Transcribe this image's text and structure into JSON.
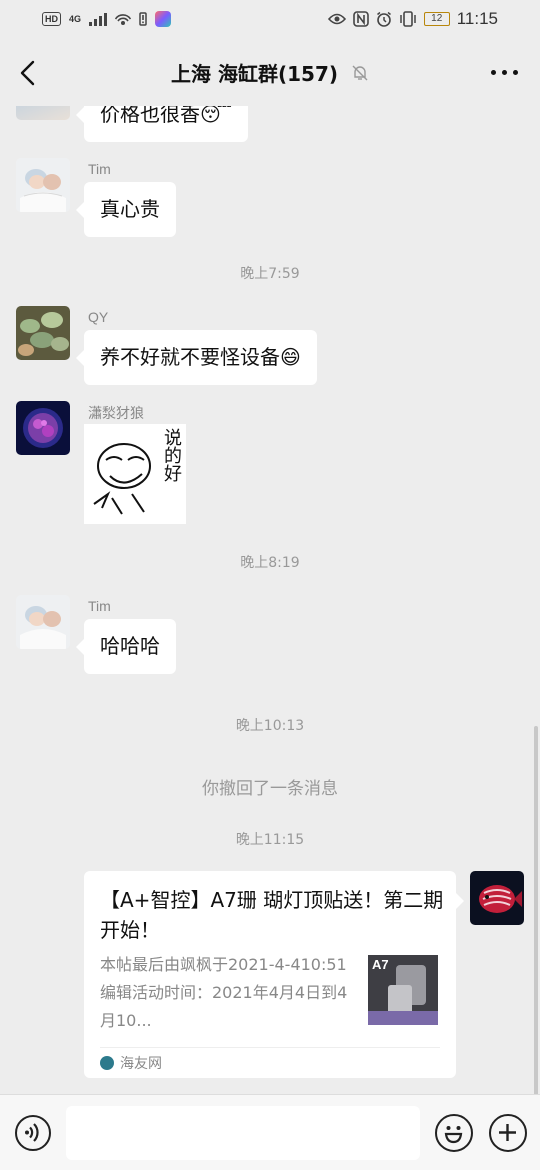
{
  "status_bar": {
    "network": "4G",
    "time": "11:15",
    "battery": "12",
    "hd_label": "HD",
    "icons": [
      "hd-icon",
      "signal-icon",
      "hotspot-icon",
      "alert-icon",
      "app-icon",
      "eye-icon",
      "nfc-icon",
      "alarm-icon",
      "vibrate-icon",
      "battery-icon"
    ]
  },
  "header": {
    "title": "上海 海缸群(157)",
    "muted": true
  },
  "messages": [
    {
      "type": "text",
      "sender": "",
      "text": "价格也很香😴"
    },
    {
      "type": "text",
      "sender": "Tim",
      "text": "真心贵"
    },
    {
      "type": "time",
      "text": "晚上7:59"
    },
    {
      "type": "text",
      "sender": "QY",
      "text": "养不好就不要怪设备😄"
    },
    {
      "type": "sticker",
      "sender": "瀟湬犲狼",
      "sticker_text": "说的好"
    },
    {
      "type": "time",
      "text": "晚上8:19"
    },
    {
      "type": "text",
      "sender": "Tim",
      "text": "哈哈哈"
    },
    {
      "type": "time",
      "text": "晚上10:13"
    },
    {
      "type": "system",
      "text": "你撤回了一条消息"
    },
    {
      "type": "time",
      "text": "晚上11:15"
    },
    {
      "type": "link",
      "sender": "self",
      "title": "【A+智控】A7珊 瑚灯顶贴送！第二期开始！",
      "desc": "本帖最后由飒枫于2021-4-410:51编辑活动时间：2021年4月4日到4月10...",
      "source": "海友网",
      "thumb_label": "A7"
    }
  ],
  "input_bar": {
    "icons": [
      "voice-icon",
      "emoji-icon",
      "plus-icon"
    ]
  }
}
